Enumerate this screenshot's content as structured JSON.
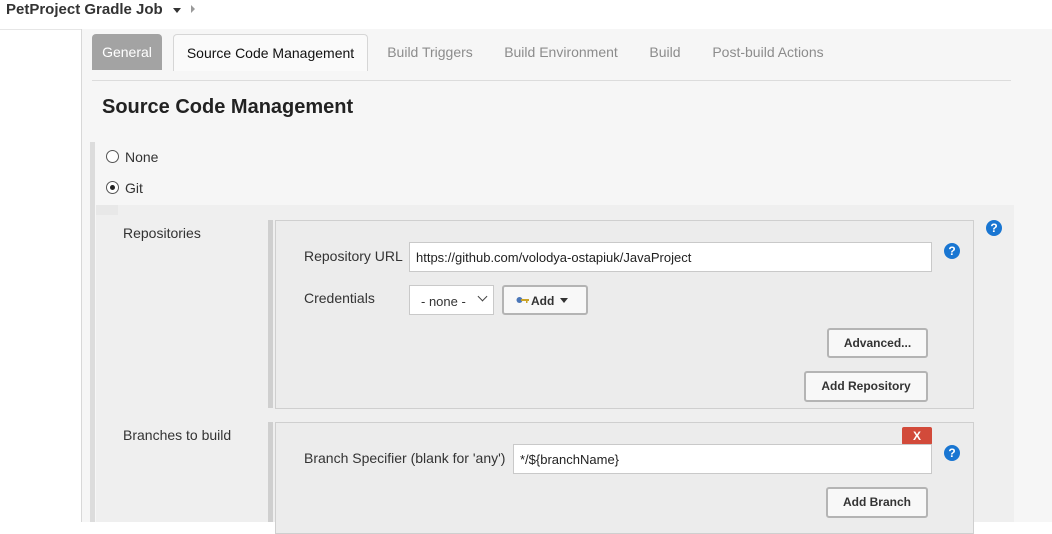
{
  "breadcrumb": {
    "job_name": "PetProject Gradle Job"
  },
  "tabs": [
    {
      "label": "General"
    },
    {
      "label": "Source Code Management"
    },
    {
      "label": "Build Triggers"
    },
    {
      "label": "Build Environment"
    },
    {
      "label": "Build"
    },
    {
      "label": "Post-build Actions"
    }
  ],
  "section_title": "Source Code Management",
  "scm_options": [
    {
      "label": "None",
      "selected": false
    },
    {
      "label": "Git",
      "selected": true
    }
  ],
  "repositories": {
    "label": "Repositories",
    "repo_url_label": "Repository URL",
    "repo_url_value": "https://github.com/volodya-ostapiuk/JavaProject",
    "credentials_label": "Credentials",
    "credentials_selected": "- none -",
    "add_label": "Add",
    "advanced_label": "Advanced...",
    "add_repository_label": "Add Repository"
  },
  "branches": {
    "label": "Branches to build",
    "delete_label": "X",
    "specifier_label": "Branch Specifier (blank for 'any')",
    "specifier_value": "*/${branchName}",
    "add_branch_label": "Add Branch"
  },
  "help_glyph": "?",
  "colors": {
    "help": "#1976d2",
    "delete": "#d24a3a",
    "general_tab": "#a3a3a3"
  }
}
